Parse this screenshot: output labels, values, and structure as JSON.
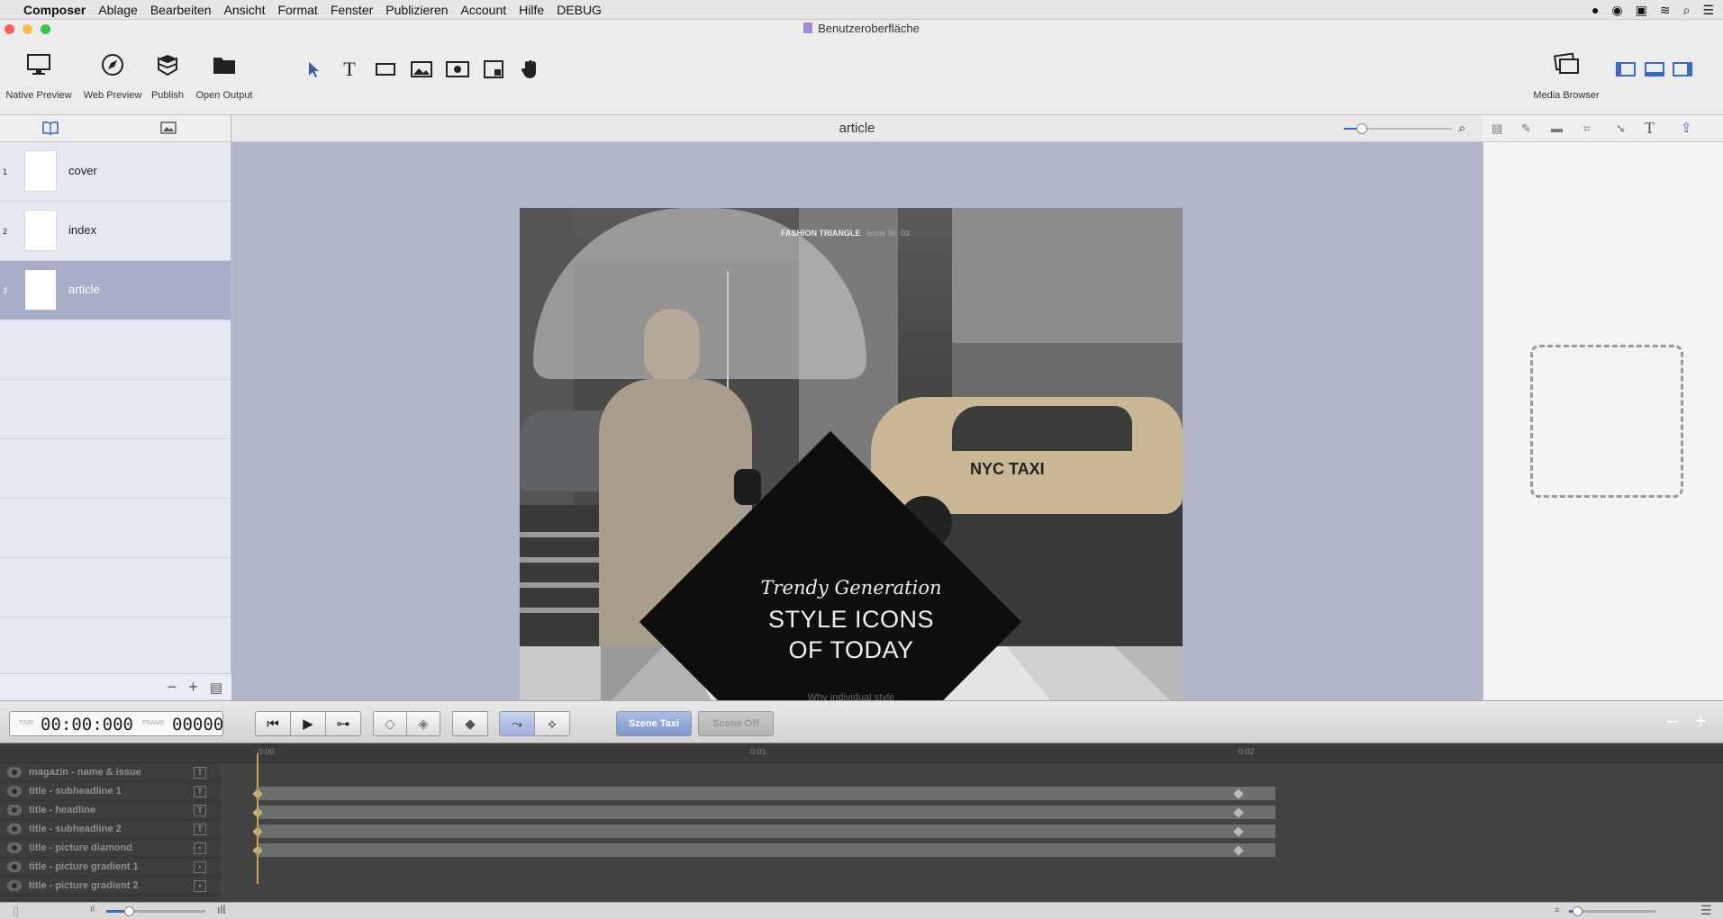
{
  "menubar": {
    "apple": "",
    "app_name": "Composer",
    "items": [
      "Ablage",
      "Bearbeiten",
      "Ansicht",
      "Format",
      "Fenster",
      "Publizieren",
      "Account",
      "Hilfe",
      "DEBUG"
    ]
  },
  "window": {
    "title": "Benutzeroberfläche"
  },
  "toolbar": {
    "native_preview": "Native Preview",
    "web_preview": "Web Preview",
    "publish": "Publish",
    "open_output": "Open Output",
    "media_browser": "Media Browser"
  },
  "pages": [
    {
      "num": "1",
      "name": "cover"
    },
    {
      "num": "2",
      "name": "index"
    },
    {
      "num": "3",
      "name": "article"
    }
  ],
  "canvas": {
    "title": "article"
  },
  "article": {
    "masthead_bold": "FASHION TRIANGLE",
    "masthead_issue": "Issue Nr. 03",
    "subheadline": "Trendy Generation",
    "headline_1": "STYLE ICONS",
    "headline_2": "OF TODAY",
    "teaser": "Why individual style",
    "taxi_text": "NYC TAXI"
  },
  "timeline": {
    "time_label": "TIME",
    "time_value": "00:00:000",
    "frame_label": "FRAME",
    "frame_value": "00000",
    "scene_1": "Szene Taxi",
    "scene_2": "Scene Off",
    "ruler": [
      "0:00",
      "0:01",
      "0:02"
    ],
    "layers": [
      {
        "name": "magazin - name & issue",
        "type": "T"
      },
      {
        "name": "title - subheadline 1",
        "type": "T"
      },
      {
        "name": "title - headline",
        "type": "T"
      },
      {
        "name": "title - subheadline 2",
        "type": "T"
      },
      {
        "name": "title - picture diamond",
        "type": "img"
      },
      {
        "name": "title - picture gradient 1",
        "type": "img"
      },
      {
        "name": "title - picture gradient 2",
        "type": "img"
      }
    ]
  },
  "colors": {
    "selection": "#a8aec8",
    "canvas_bg": "#b1b6c9",
    "playhead": "#c9a348",
    "scene_btn": "#8aa6d8"
  }
}
